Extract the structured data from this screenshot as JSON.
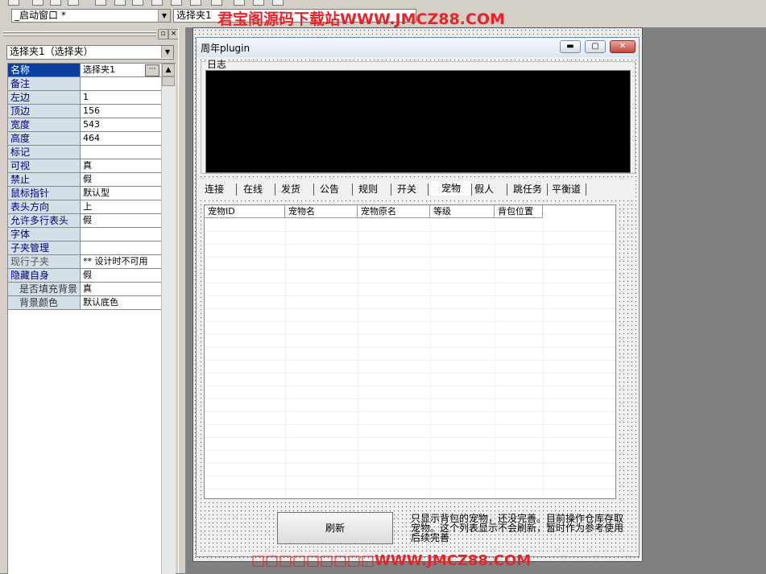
{
  "toolbar": {
    "window_combo": "_启动窗口 *",
    "control_combo": "选择夹1",
    "watermark": "君宝阁源码下载站WWW.JMCZ88.COM"
  },
  "property_panel": {
    "object_combo": "选择夹1（选择夹）",
    "properties": [
      {
        "name": "名称",
        "value": "选择夹1"
      },
      {
        "name": "备注",
        "value": ""
      },
      {
        "name": "左边",
        "value": "1"
      },
      {
        "name": "顶边",
        "value": "156"
      },
      {
        "name": "宽度",
        "value": "543"
      },
      {
        "name": "高度",
        "value": "464"
      },
      {
        "name": "标记",
        "value": ""
      },
      {
        "name": "可视",
        "value": "真"
      },
      {
        "name": "禁止",
        "value": "假"
      },
      {
        "name": "鼠标指针",
        "value": "默认型"
      },
      {
        "name": "表头方向",
        "value": "上"
      },
      {
        "name": "允许多行表头",
        "value": "假"
      },
      {
        "name": "字体",
        "value": ""
      },
      {
        "name": "子夹管理",
        "value": ""
      },
      {
        "name": "现行子夹",
        "value": "** 设计时不可用"
      },
      {
        "name": "隐藏自身",
        "value": "假"
      },
      {
        "name": "是否填充背景",
        "value": "真"
      },
      {
        "name": "背景颜色",
        "value": "默认底色"
      }
    ]
  },
  "window": {
    "title": "周年plugin",
    "log_label": "日志",
    "tabs": [
      "连接",
      "在线",
      "发货",
      "公告",
      "规则",
      "开关",
      "宠物",
      "假人",
      "跳任务",
      "平衡道"
    ],
    "active_tab": "宠物",
    "columns": [
      "宠物ID",
      "宠物名",
      "宠物原名",
      "等级",
      "背包位置"
    ],
    "refresh_label": "刷新",
    "note": "只显示背包的宠物，还没完善。目前操作仓库存取宠物。这个列表显示不会刷新，暂时作为参考使用 后续完善"
  },
  "bottom_watermark": "□□□□□□□□□WWW.JMCZ88.COM",
  "colors": {
    "watermark": "#e8242a",
    "selection": "#0a3fa0",
    "log_bg": "#000000"
  }
}
